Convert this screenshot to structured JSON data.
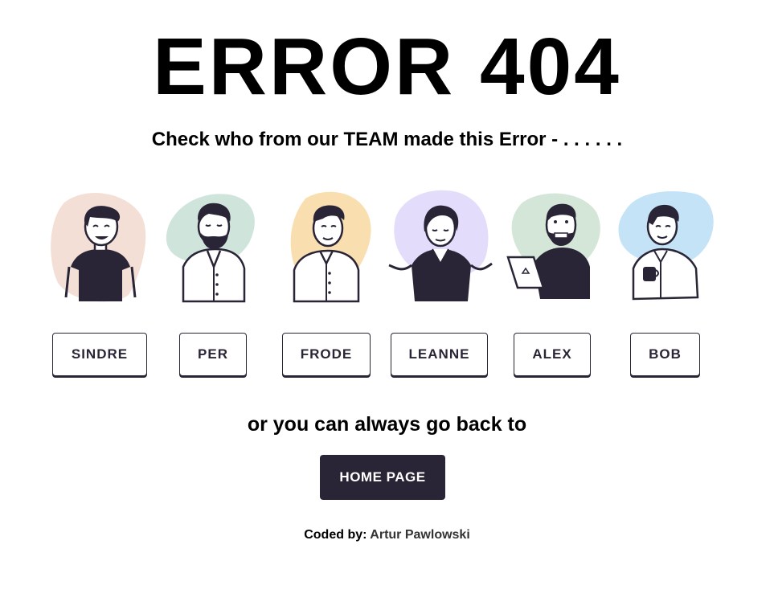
{
  "page": {
    "title": "ERROR 404",
    "subtitle": "Check who from our TEAM made this Error - . . . . . .",
    "back_text": "or you can always go back to",
    "home_button": "HOME PAGE",
    "credits_label": "Coded by:",
    "credits_author": "Artur Pawlowski"
  },
  "team": [
    {
      "name": "SINDRE",
      "icon": "man-smiling-tshirt-illustration",
      "blob_color": "#f3dfd6"
    },
    {
      "name": "PER",
      "icon": "bearded-man-illustration",
      "blob_color": "#cfe5dc"
    },
    {
      "name": "FRODE",
      "icon": "man-shirt-illustration",
      "blob_color": "#f9dfb0"
    },
    {
      "name": "LEANNE",
      "icon": "woman-shrugging-illustration",
      "blob_color": "#e3dcfb"
    },
    {
      "name": "ALEX",
      "icon": "man-laptop-illustration",
      "blob_color": "#d3e6d8"
    },
    {
      "name": "BOB",
      "icon": "man-coffee-illustration",
      "blob_color": "#c4e3f7"
    }
  ],
  "colors": {
    "dark": "#2a2536",
    "background": "#ffffff"
  }
}
